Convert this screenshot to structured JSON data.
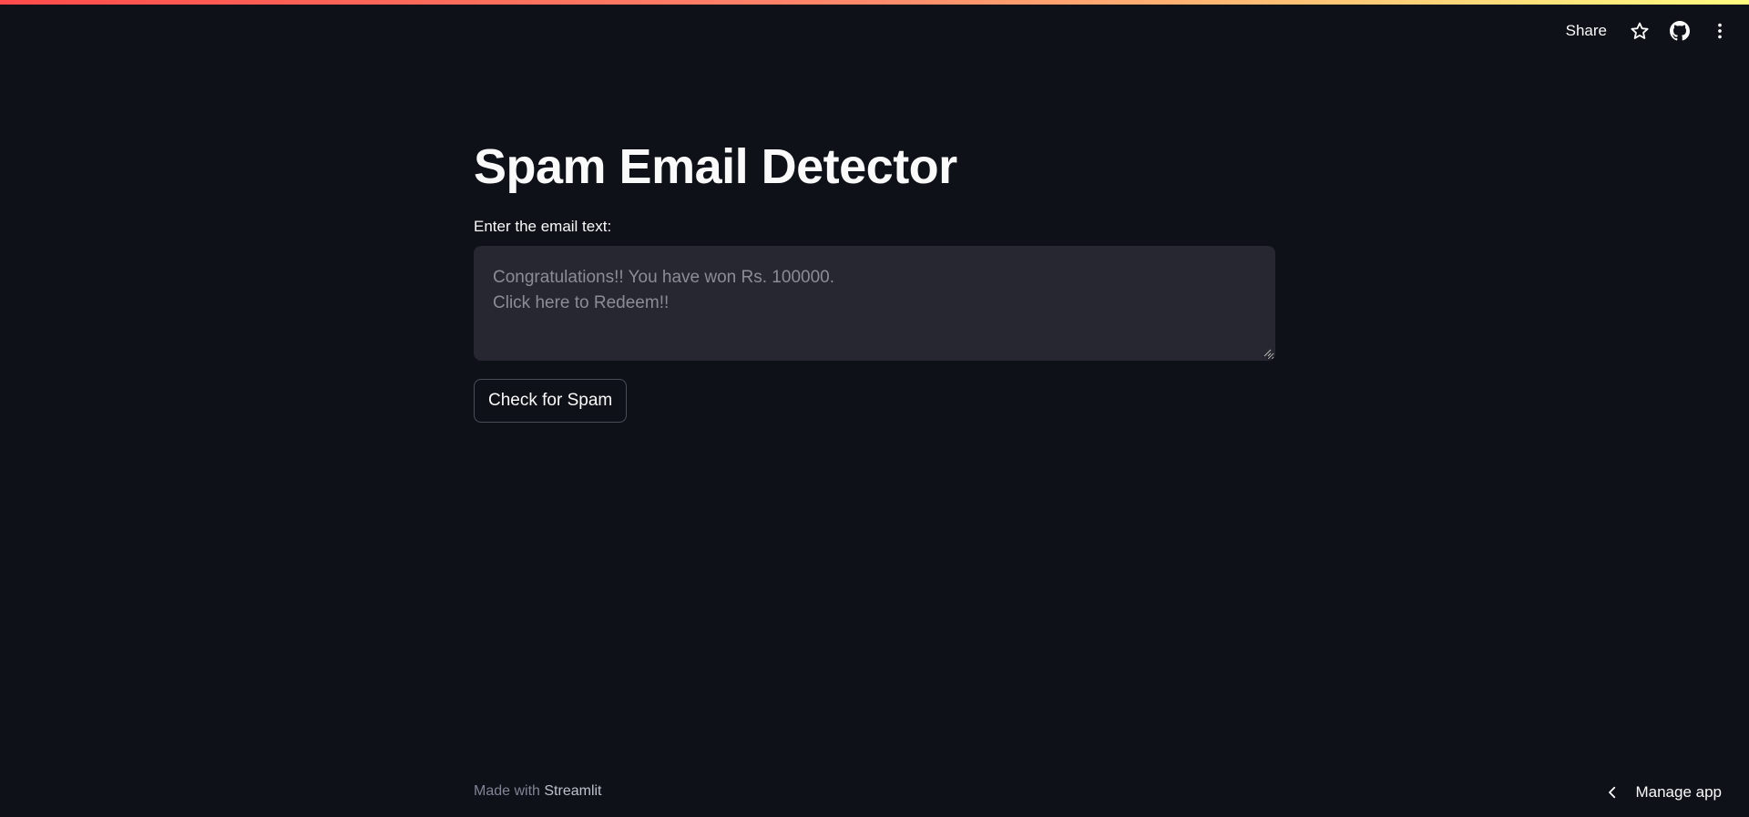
{
  "toolbar": {
    "share_label": "Share",
    "icons": [
      "star-icon",
      "github-icon",
      "more-vertical-icon"
    ]
  },
  "main": {
    "title": "Spam Email Detector",
    "input_label": "Enter the email text:",
    "textarea_placeholder": "Congratulations!! You have won Rs. 100000.\nClick here to Redeem!!",
    "textarea_value": "",
    "check_button_label": "Check for Spam"
  },
  "footer": {
    "made_with": "Made with ",
    "brand": "Streamlit"
  },
  "manage_app": {
    "label": "Manage app",
    "icon": "chevron-left-icon"
  },
  "colors": {
    "background": "#0e1117",
    "textarea_bg": "#262730",
    "accent_gradient_start": "#ff4b4b",
    "accent_gradient_end": "#fffd80"
  }
}
